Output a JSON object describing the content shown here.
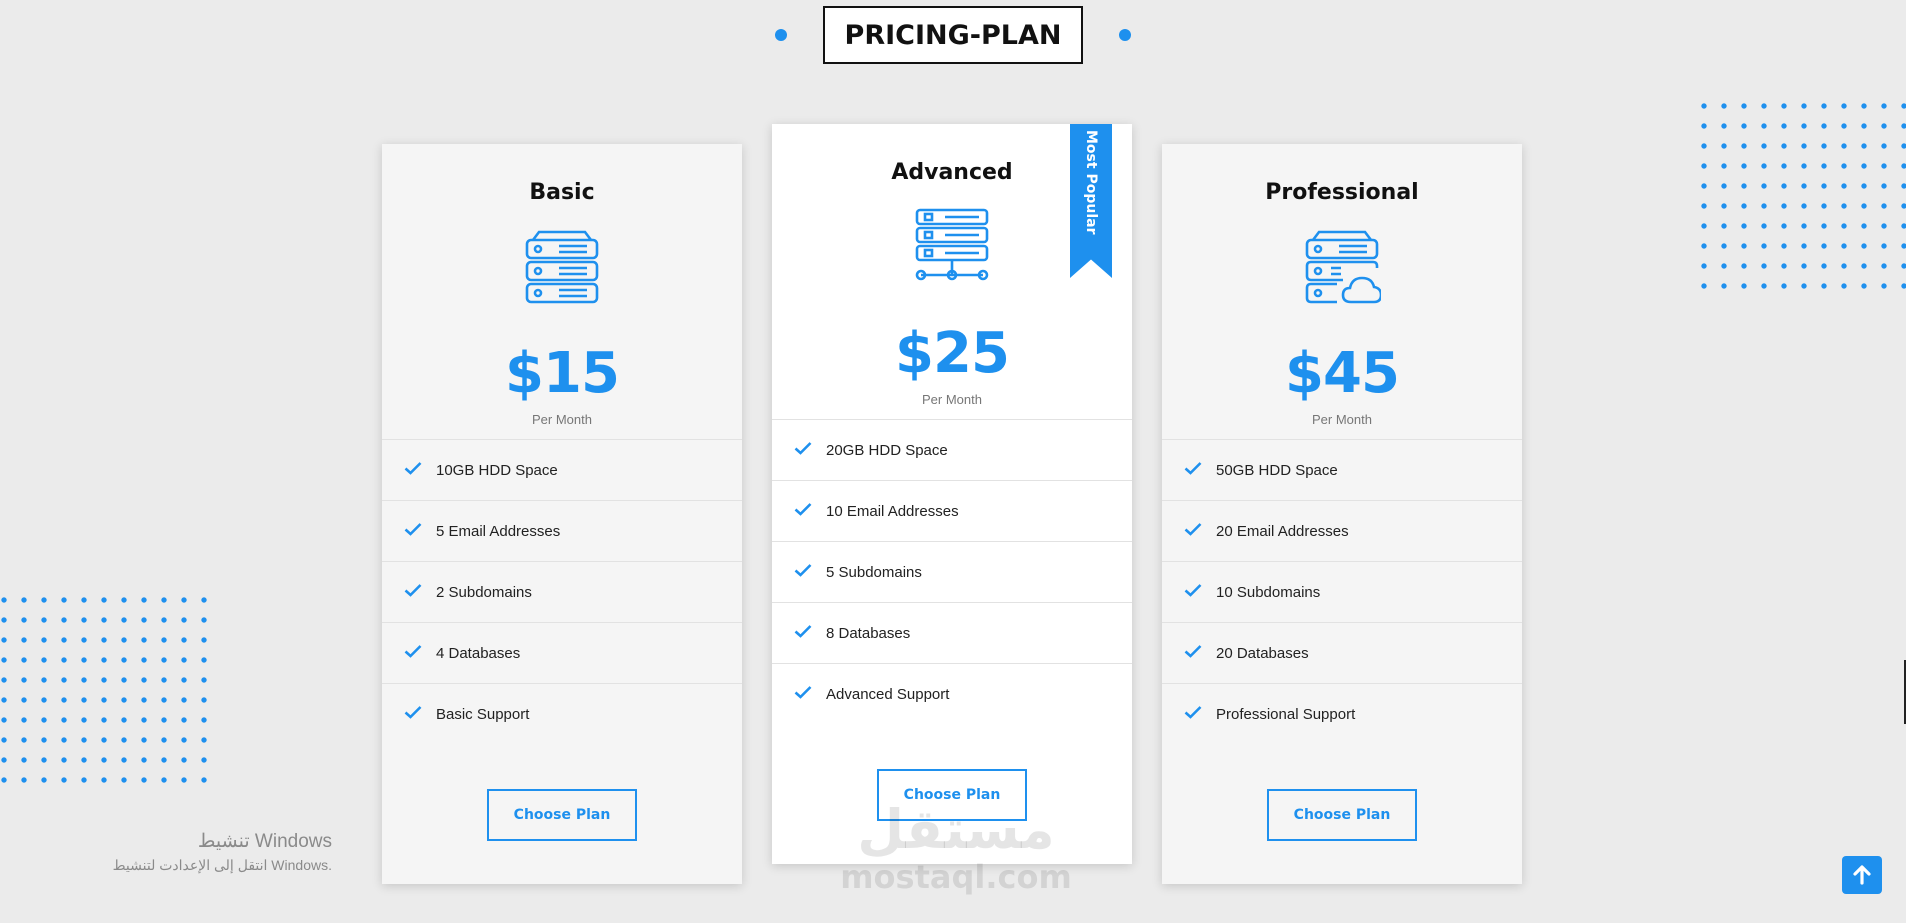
{
  "page_title": "PRICING-PLAN",
  "plans": [
    {
      "name": "Basic",
      "icon": "server-icon",
      "price": "$15",
      "period": "Per Month",
      "features": [
        "10GB HDD Space",
        "5 Email Addresses",
        "2 Subdomains",
        "4 Databases",
        "Basic Support"
      ],
      "button_label": "Choose Plan"
    },
    {
      "name": "Advanced",
      "icon": "server-network-icon",
      "price": "$25",
      "period": "Per Month",
      "badge": "Most Popular",
      "features": [
        "20GB HDD Space",
        "10 Email Addresses",
        "5 Subdomains",
        "8 Databases",
        "Advanced Support"
      ],
      "button_label": "Choose Plan"
    },
    {
      "name": "Professional",
      "icon": "server-cloud-icon",
      "price": "$45",
      "period": "Per Month",
      "features": [
        "50GB HDD Space",
        "20 Email Addresses",
        "10 Subdomains",
        "20 Databases",
        "Professional Support"
      ],
      "button_label": "Choose Plan"
    }
  ],
  "watermark": {
    "arabic": "مستقل",
    "latin": "mostaql.com"
  },
  "windows_activation": {
    "title": "تنشيط Windows",
    "subtitle": "انتقل إلى الإعدادت لتنشيط Windows."
  },
  "scroll_top_icon": "arrow-up-icon",
  "colors": {
    "accent": "#1e90ee",
    "background": "#ebebeb",
    "card": "#f5f5f5",
    "featured_card": "#ffffff"
  }
}
